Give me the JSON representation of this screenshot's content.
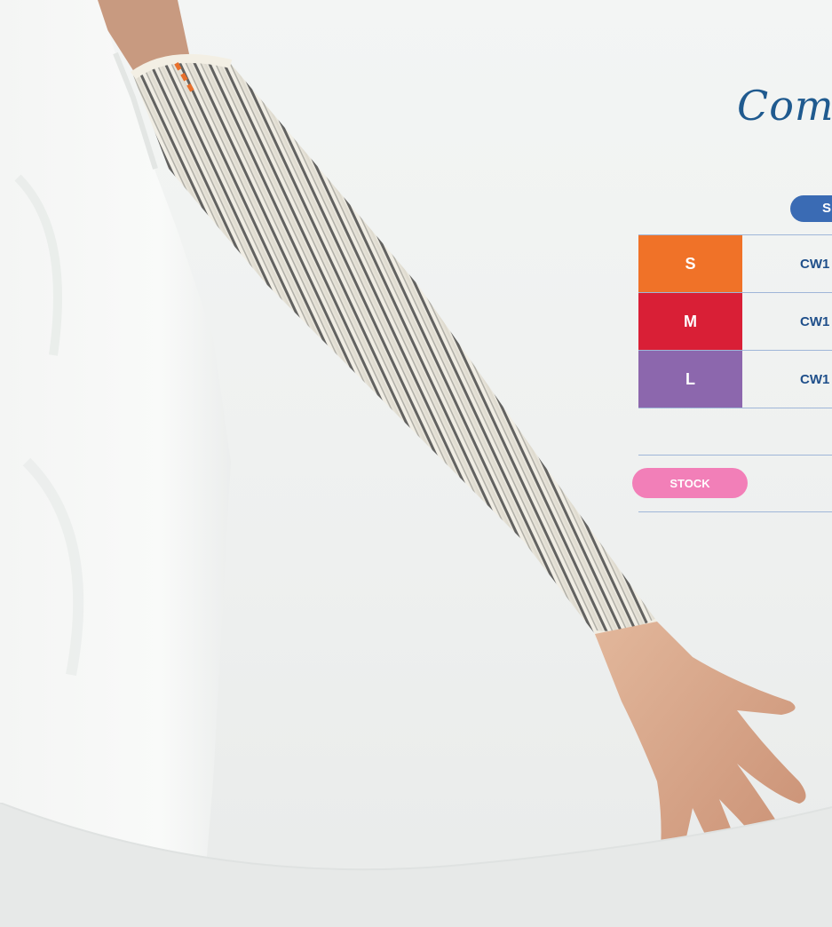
{
  "title": "Com",
  "table": {
    "header": "S",
    "rows": [
      {
        "size": "S",
        "code": "CW1",
        "color": "#f07228"
      },
      {
        "size": "M",
        "code": "CW1",
        "color": "#d91f36"
      },
      {
        "size": "L",
        "code": "CW1",
        "color": "#8c67ad"
      }
    ]
  },
  "stock": {
    "label": "STOCK",
    "color": "#f27fb8"
  },
  "colors": {
    "accent_blue": "#3a6bb4",
    "text_blue": "#1f4f8a",
    "divider": "#9fb6d8"
  }
}
